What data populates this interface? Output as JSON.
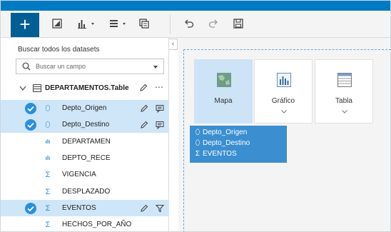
{
  "toolbar": {
    "add_label": "+",
    "icons": [
      "swap-icon",
      "chart-icon",
      "table-icon",
      "copy-icon",
      "undo-icon",
      "redo-icon",
      "save-icon"
    ]
  },
  "sidebar": {
    "title": "Buscar todos los datasets",
    "search": {
      "placeholder": "Buscar un campo",
      "value": ""
    },
    "dataset": {
      "name": "DEPARTAMENTOS.Table"
    },
    "fields": [
      {
        "label": "Depto_Origen",
        "type": "location",
        "selected": true
      },
      {
        "label": "Depto_Destino",
        "type": "location",
        "selected": true
      },
      {
        "label": "DEPARTAMEN",
        "type": "string",
        "selected": false
      },
      {
        "label": "DEPTO_RECE",
        "type": "string",
        "selected": false
      },
      {
        "label": "VIGENCIA",
        "type": "number",
        "selected": false
      },
      {
        "label": "DESPLAZADO",
        "type": "number",
        "selected": false
      },
      {
        "label": "EVENTOS",
        "type": "number",
        "selected": true
      },
      {
        "label": "HECHOS_POR_AÑO",
        "type": "number",
        "selected": false
      }
    ]
  },
  "canvas": {
    "viz_options": [
      {
        "label": "Mapa",
        "active": true
      },
      {
        "label": "Gráfico",
        "active": false
      },
      {
        "label": "Tabla",
        "active": false
      }
    ],
    "drag_items": [
      {
        "glyph": "⬯",
        "label": "Depto_Origen"
      },
      {
        "glyph": "⬯",
        "label": "Depto_Destino"
      },
      {
        "glyph": "Σ",
        "label": "EVENTOS"
      }
    ]
  },
  "colors": {
    "accent": "#007ac2",
    "selected_row": "#cfe6f8",
    "drag_box": "#3b8fd0"
  }
}
